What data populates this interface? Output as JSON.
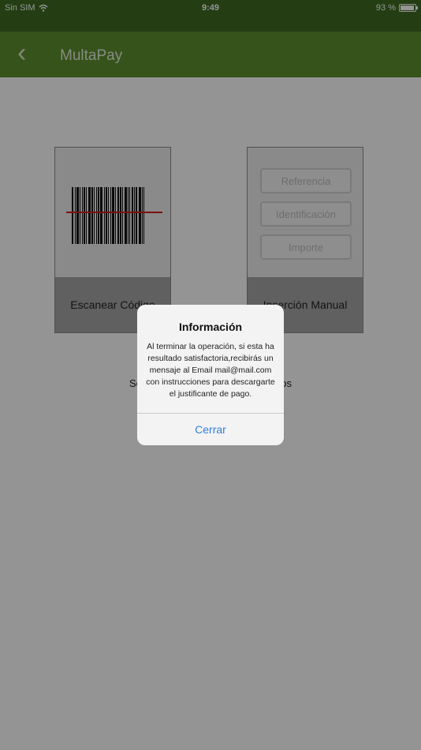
{
  "status_bar": {
    "carrier": "Sin SIM",
    "time": "9:49",
    "battery_text": "93 %",
    "battery_level": 0.93
  },
  "nav": {
    "title": "MultaPay",
    "back_glyph": "‹"
  },
  "cards": {
    "scan": {
      "label": "Escanear Código"
    },
    "manual": {
      "label": "Inserción Manual",
      "fields": [
        "Referencia",
        "Identificación",
        "Importe"
      ]
    }
  },
  "select_text": "Seleccione uno de los dos formatos",
  "dialog": {
    "title": "Información",
    "message": "Al terminar la operación, si esta ha resultado satisfactoria,recibirás un mensaje al Email mail@mail.com con instrucciones para descargarte el justificante de pago.",
    "button": "Cerrar"
  },
  "colors": {
    "nav_bar": "#5c8f2e",
    "status_bar": "#3e6a22",
    "scan_line": "#d21a1a",
    "dialog_button": "#2f7de1"
  },
  "icons": {
    "back": "chevron-left-icon",
    "wifi": "wifi-icon",
    "battery": "battery-icon",
    "barcode": "barcode-icon"
  }
}
